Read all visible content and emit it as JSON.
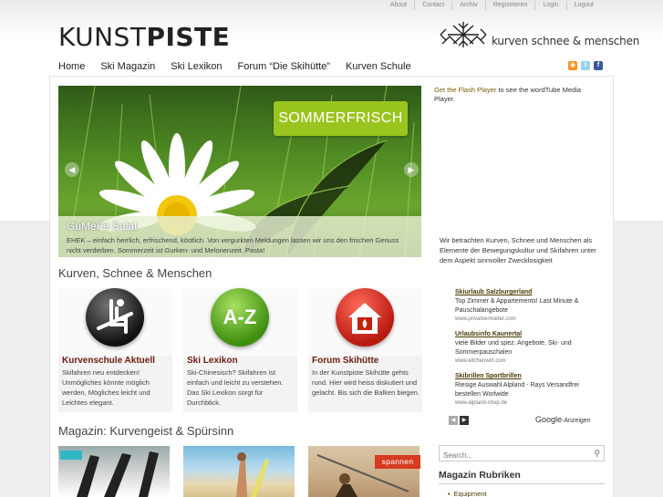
{
  "topbar": [
    "About",
    "Contact",
    "Archiv",
    "Registrieren",
    "Login",
    "Logout"
  ],
  "logo": {
    "part1": "KUNST",
    "part2": "PISTE"
  },
  "brand_tagline": "kurven schnee & menschen",
  "nav": [
    "Home",
    "Ski Magazin",
    "Ski Lexikon",
    "Forum “Die Skihütte”",
    "Kurven Schule"
  ],
  "social_icons": [
    "rss-icon",
    "twitter-icon",
    "facebook-icon"
  ],
  "slider": {
    "badge": "SOMMERFRISCH",
    "title": "GuMeFe Salat",
    "text": "EHEK – einfach herrlich, erfrischend, köstlich. Von vergurkten Meldungen lassen wir uns den frischen Genuss nicht verderben. Sommerzeit ist Gurken- und Melonenzeit. Pasta!"
  },
  "section1_title": "Kurven, Schnee & Menschen",
  "cards": [
    {
      "title": "Kurvenschule Aktuell",
      "text": "Skifahren neu entdecken! Unmögliches könnte möglich werden, Mögliches leicht und Leichtes elegant.",
      "icon": "ski-lift-chair-icon"
    },
    {
      "title": "Ski Lexikon",
      "text": "Ski-Chinesisch? Skifahren ist einfach und leicht zu verstehen. Das Ski Lexikon sorgt für Durchblick.",
      "icon": "a-z-icon",
      "icon_text": "A-Z"
    },
    {
      "title": "Forum Skihütte",
      "text": "In der Kunstpiste Skihütte gehts rund. Hier wird heiss diskutiert und gelacht. Bis sich die Balken biegen.",
      "icon": "house-fire-icon"
    }
  ],
  "section2_title": "Magazin: Kurvengeist & Spürsinn",
  "thumbs": [
    {
      "label": ""
    },
    {
      "label": ""
    },
    {
      "label": "spannen"
    }
  ],
  "flash": {
    "link": "Get the Flash Player",
    "text": " to see the wordTube Media Player."
  },
  "about_text": "Wir betrachten Kurven, Schnee und Menschen als Elemente der Bewegungskultur und Skifahren unter dem Aspekt sinnvoller Zwecklosigkeit",
  "ads": [
    {
      "title": "Skiurlaub Salzburgerland",
      "desc": "Top Zimmer & Appartements! Last Minute & Pauschalangebote",
      "url": "www.privatvermieter.com"
    },
    {
      "title": "Urlaubsinfo Kaunertal",
      "desc": "viele Bilder und spez. Angebote, Ski- und Sommerpauschalen",
      "url": "www.kitchenwirt.com"
    },
    {
      "title": "Skibrillen Sportbrillen",
      "desc": "Riesige Auswahl Alpland - Rays Versandfrei bestellen Worlwide",
      "url": "www.alpland-shop.de"
    }
  ],
  "google": {
    "brand": "Google",
    "label": "-Anzeigen"
  },
  "search": {
    "placeholder": "Search..."
  },
  "rubriken": {
    "title": "Magazin Rubriken",
    "first_item": "Equipment"
  }
}
